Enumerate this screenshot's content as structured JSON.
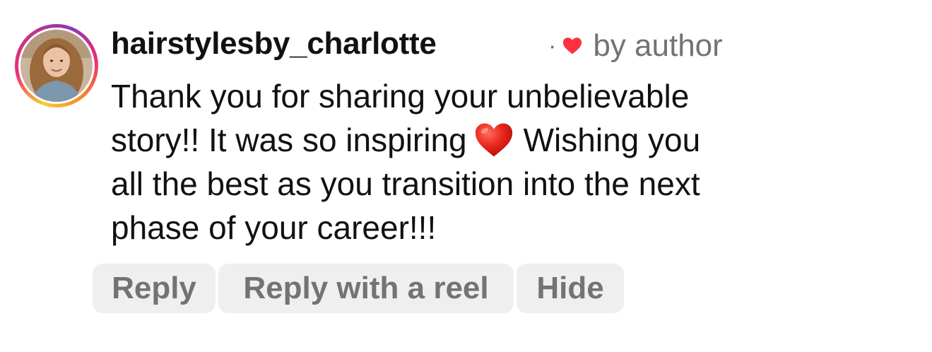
{
  "comment": {
    "username": "hairstylesby_charlotte",
    "separator": "·",
    "liked_by_author_label": "by author",
    "text_lines": [
      "Thank you for sharing your unbelievable",
      "story!! It was so inspiring",
      "Wishing you",
      "all the best as you transition into the next",
      "phase of your career!!!"
    ],
    "emoji": "red-heart"
  },
  "actions": {
    "reply_label": "Reply",
    "reply_with_reel_label": "Reply with a reel",
    "hide_label": "Hide"
  },
  "colors": {
    "text": "#111111",
    "muted": "#737373",
    "pill_bg": "#efefef",
    "heart": "#ff3040"
  },
  "icons": {
    "liked_indicator": "heart-icon",
    "avatar": "profile-photo"
  }
}
